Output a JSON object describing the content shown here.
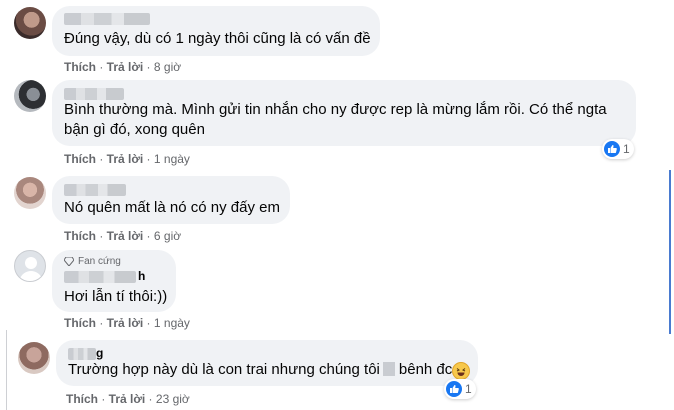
{
  "comments": [
    {
      "text": "Đúng vậy, dù có 1 ngày thôi cũng là có vấn đề",
      "like": "Thích",
      "reply": "Trả lời",
      "time": "8 giờ"
    },
    {
      "text1": "Bình thường mà. Mình gửi tin nhắn cho ny được rep là mừng lắm rồi. Có thể ngta",
      "text2": "bận gì đó, xong quên",
      "like": "Thích",
      "reply": "Trả lời",
      "time": "1 ngày",
      "reaction_count": "1"
    },
    {
      "text": "Nó quên mất là nó có ny đấy em",
      "like": "Thích",
      "reply": "Trả lời",
      "time": "6 giờ"
    },
    {
      "badge": "Fan cứng",
      "name_fragment": "h",
      "text": "Hơi lẫn tí thôi:))",
      "like": "Thích",
      "reply": "Trả lời",
      "time": "1 ngày"
    },
    {
      "name_fragment": "g",
      "text_a": "Trường hợp này dù là con trai nhưng chúng tôi",
      "text_b": "bênh đc",
      "like": "Thích",
      "reply": "Trả lời",
      "time": "23 giờ",
      "reaction_count": "1"
    }
  ],
  "icons": {
    "like": "like-icon",
    "haha": "haha-emoji-icon",
    "diamond": "diamond-icon"
  },
  "colors": {
    "bubble": "#f0f2f5",
    "meta_text": "#65676b",
    "like_blue": "#1877f2"
  }
}
